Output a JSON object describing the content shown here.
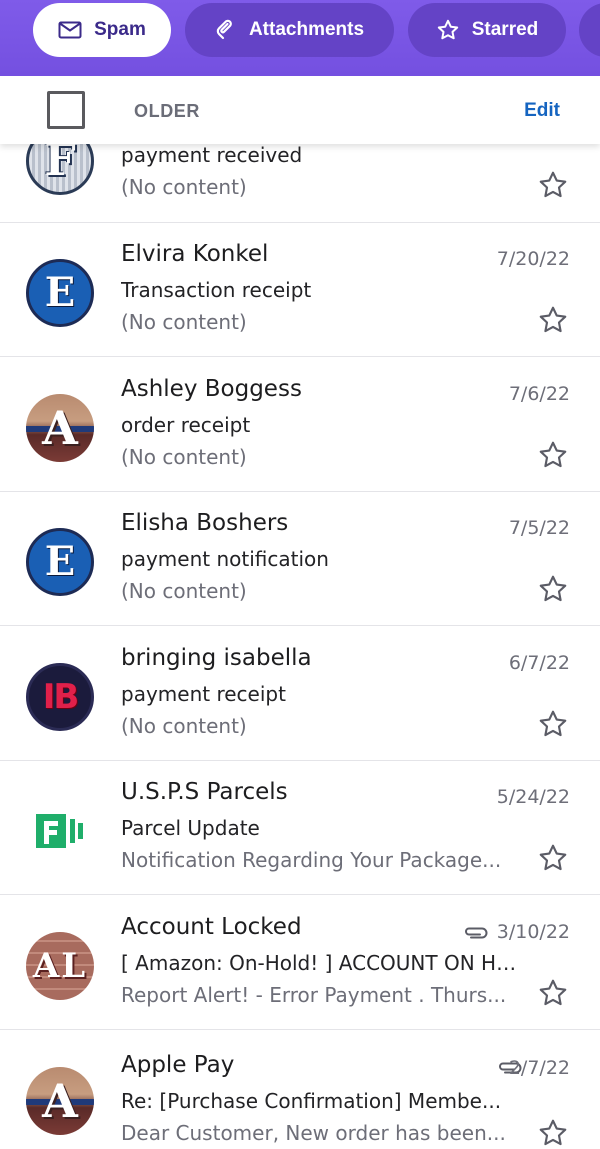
{
  "filters": [
    {
      "label": "Spam",
      "icon": "mail-icon",
      "active": true
    },
    {
      "label": "Attachments",
      "icon": "paperclip-icon",
      "active": false
    },
    {
      "label": "Starred",
      "icon": "star-icon",
      "active": false
    }
  ],
  "section": {
    "title": "OLDER",
    "edit_label": "Edit"
  },
  "messages": [
    {
      "sender": "",
      "subject": "payment received",
      "snippet": "(No content)",
      "date": "",
      "avatar_text": "F",
      "has_attachment": false
    },
    {
      "sender": "Elvira Konkel",
      "subject": "Transaction receipt",
      "snippet": "(No content)",
      "date": "7/20/22",
      "avatar_text": "E",
      "has_attachment": false
    },
    {
      "sender": "Ashley Boggess",
      "subject": "order receipt",
      "snippet": "(No content)",
      "date": "7/6/22",
      "avatar_text": "A",
      "has_attachment": false
    },
    {
      "sender": "Elisha Boshers",
      "subject": "payment notification",
      "snippet": "(No content)",
      "date": "7/5/22",
      "avatar_text": "E",
      "has_attachment": false
    },
    {
      "sender": "bringing isabella",
      "subject": "payment receipt",
      "snippet": "(No content)",
      "date": "6/7/22",
      "avatar_text": "IB",
      "has_attachment": false
    },
    {
      "sender": "U.S.P.S Parcels",
      "subject": "Parcel Update",
      "snippet": "Notification Regarding Your Package...",
      "date": "5/24/22",
      "avatar_text": "",
      "has_attachment": false
    },
    {
      "sender": "Account Locked",
      "subject": "[ Amazon: On-Hold! ] ACCOUNT ON HO...",
      "snippet": "Report Alert! - Error Payment . Thurs...",
      "date": "3/10/22",
      "avatar_text": "AL",
      "has_attachment": true
    },
    {
      "sender": "Apple Pay",
      "subject": "Re: [Purchase Confirmation] Membe...",
      "snippet": "Dear Customer, New order has been...",
      "date": "2/7/22",
      "avatar_text": "A",
      "has_attachment": true
    }
  ],
  "colors": {
    "brand": "#7e58e8",
    "link": "#1564c0",
    "muted": "#6d6e78"
  }
}
